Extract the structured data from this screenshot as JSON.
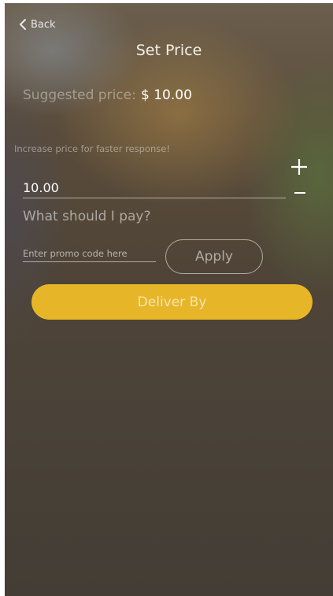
{
  "header": {
    "back_label": "Back",
    "title": "Set Price"
  },
  "suggested": {
    "label": "Suggested price:",
    "value": "$ 10.00"
  },
  "hint": "Increase price for faster response!",
  "price": {
    "value": "10.00",
    "increment_symbol": "+",
    "decrement_symbol": "-"
  },
  "pay_label": "What should I pay?",
  "promo": {
    "placeholder": "Enter promo code here",
    "value": "",
    "apply_label": "Apply"
  },
  "deliver_label": "Deliver By",
  "colors": {
    "accent": "#e6b628",
    "text": "#ffffff"
  },
  "icons": {
    "back": "chevron-left-icon",
    "increment": "plus-icon",
    "decrement": "minus-icon"
  }
}
